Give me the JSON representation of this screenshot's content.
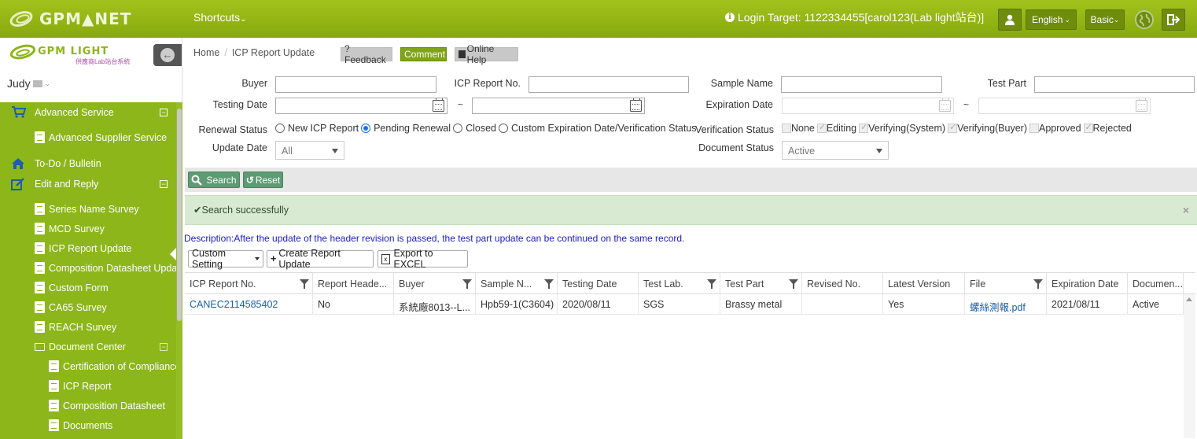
{
  "topbar": {
    "logo_text": "GPM▲NET",
    "shortcuts": "Shortcuts",
    "login_target": "Login Target: 1122334455[carol123(Lab light站台)]",
    "language": "English",
    "mode": "Basic"
  },
  "sidebar": {
    "logo_text": "GPM LIGHT",
    "logo_sub": "供應商Lab站台系統",
    "user": "Judy",
    "items": [
      {
        "label": "Advanced Service",
        "toggle": "−"
      },
      {
        "label": "Advanced Supplier Service"
      },
      {
        "label": "To-Do / Bulletin"
      },
      {
        "label": "Edit and Reply",
        "toggle": "−"
      },
      {
        "label": "Series Name Survey"
      },
      {
        "label": "MCD Survey"
      },
      {
        "label": "ICP Report Update"
      },
      {
        "label": "Composition Datasheet Update"
      },
      {
        "label": "Custom Form"
      },
      {
        "label": "CA65 Survey"
      },
      {
        "label": "REACH Survey"
      },
      {
        "label": "Document Center",
        "toggle": "−"
      },
      {
        "label": "Certification of Compliance"
      },
      {
        "label": "ICP Report"
      },
      {
        "label": "Composition Datasheet"
      },
      {
        "label": "Documents"
      }
    ]
  },
  "breadcrumb": {
    "home": "Home",
    "current": "ICP Report Update"
  },
  "header_buttons": {
    "feedback": "?Feedback",
    "comment": "Comment",
    "help": "Online Help"
  },
  "filters": {
    "buyer_label": "Buyer",
    "icp_no_label": "ICP Report No.",
    "sample_label": "Sample Name",
    "test_part_label": "Test Part",
    "testing_date_label": "Testing Date",
    "expiration_date_label": "Expiration Date",
    "tilde": "~",
    "renewal_label": "Renewal Status",
    "renewal_options": [
      "New ICP Report",
      "Pending Renewal",
      "Closed",
      "Custom Expiration Date/Verification Status"
    ],
    "renewal_selected": "Pending Renewal",
    "verification_label": "Verification Status",
    "verification_options": [
      "None",
      "Editing",
      "Verifying(System)",
      "Verifying(Buyer)",
      "Approved",
      "Rejected"
    ],
    "update_date_label": "Update Date",
    "update_date_value": "All",
    "document_status_label": "Document Status",
    "document_status_value": "Active"
  },
  "actions": {
    "search": "Search",
    "reset": "Reset"
  },
  "alert": {
    "message": "Search successfully",
    "close": "×"
  },
  "description": "Description:After the update of the header revision is passed, the test part update can be continued on the same record.",
  "toolbar": {
    "custom": "Custom Setting",
    "create": "Create Report Update",
    "export": "Export to EXCEL"
  },
  "table": {
    "columns": [
      "ICP Report No.",
      "Report Heade...",
      "Buyer",
      "Sample N...",
      "Testing Date",
      "Test Lab.",
      "Test Part",
      "Revised No.",
      "Latest Version",
      "File",
      "Expiration Date",
      "Documen..."
    ],
    "rows": [
      [
        "CANEC2114585402",
        "No",
        "系統廠8013--L...",
        "Hpb59-1(C3604)",
        "2020/08/11",
        "SGS",
        "Brassy metal",
        "",
        "Yes",
        "螺絲測報.pdf",
        "2021/08/11",
        "Active"
      ]
    ]
  }
}
